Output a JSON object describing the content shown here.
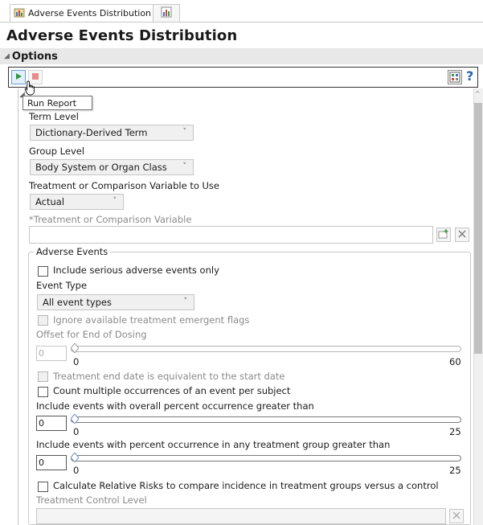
{
  "tabs": [
    {
      "label": "Adverse Events Distribution",
      "icon": "report-tab-icon"
    },
    {
      "label": "",
      "icon": "chart-tab-icon"
    }
  ],
  "page_title": "Adverse Events Distribution",
  "options": {
    "header": "Options",
    "tooltip": "Run Report"
  },
  "form": {
    "term_level_label": "Term Level",
    "term_level_value": "Dictionary-Derived Term",
    "group_level_label": "Group Level",
    "group_level_value": "Body System or Organ Class",
    "treatment_var_label": "Treatment or Comparison Variable to Use",
    "treatment_var_value": "Actual",
    "treatment_comparison_label": "*Treatment or Comparison Variable",
    "treatment_comparison_value": ""
  },
  "adverse_events": {
    "title": "Adverse Events",
    "serious_only": "Include serious adverse events only",
    "event_type_label": "Event Type",
    "event_type_value": "All event types",
    "ignore_flags": "Ignore available treatment emergent flags",
    "offset_label": "Offset for End of Dosing",
    "offset_value": "0",
    "offset_min": "0",
    "offset_max": "60",
    "treatment_end": "Treatment end date is equivalent to the start date",
    "count_multiple": "Count multiple occurrences of an event per subject",
    "overall_label": "Include events with overall percent occurrence greater than",
    "overall_value": "0",
    "overall_min": "0",
    "overall_max": "25",
    "any_group_label": "Include events with percent occurrence in any treatment group greater than",
    "any_group_value": "0",
    "any_group_min": "0",
    "any_group_max": "25",
    "relative_risks": "Calculate Relative Risks to compare incidence in treatment groups versus a control",
    "control_level_label": "Treatment Control Level",
    "control_level_value": ""
  },
  "colors": {
    "run_accent": "#2f9a3a",
    "stop_accent": "#e38d8d",
    "help_accent": "#2465b3"
  }
}
